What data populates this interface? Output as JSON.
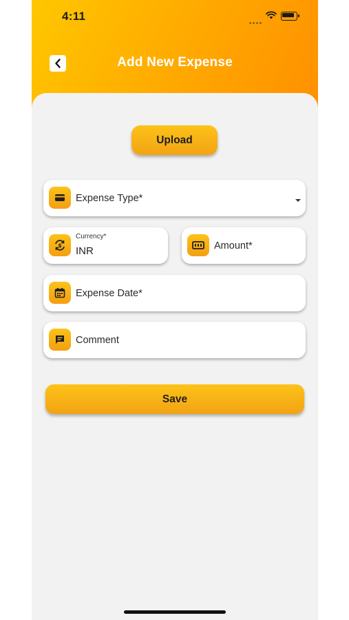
{
  "status_bar": {
    "time": "4:11"
  },
  "header": {
    "title": "Add New Expense",
    "back_icon": "chevron-left-icon"
  },
  "upload": {
    "label": "Upload"
  },
  "form": {
    "expense_type": {
      "label": "Expense Type*",
      "icon": "wallet-icon"
    },
    "currency": {
      "label": "Currency*",
      "value": "INR",
      "icon": "currency-exchange-icon"
    },
    "amount": {
      "label": "Amount*",
      "icon": "cash-icon"
    },
    "expense_date": {
      "label": "Expense Date*",
      "icon": "calendar-icon"
    },
    "comment": {
      "label": "Comment",
      "icon": "comment-icon"
    }
  },
  "save": {
    "label": "Save"
  },
  "colors": {
    "accent": "#ffad00",
    "button": "#f9b515",
    "background": "#f2f2f2"
  }
}
